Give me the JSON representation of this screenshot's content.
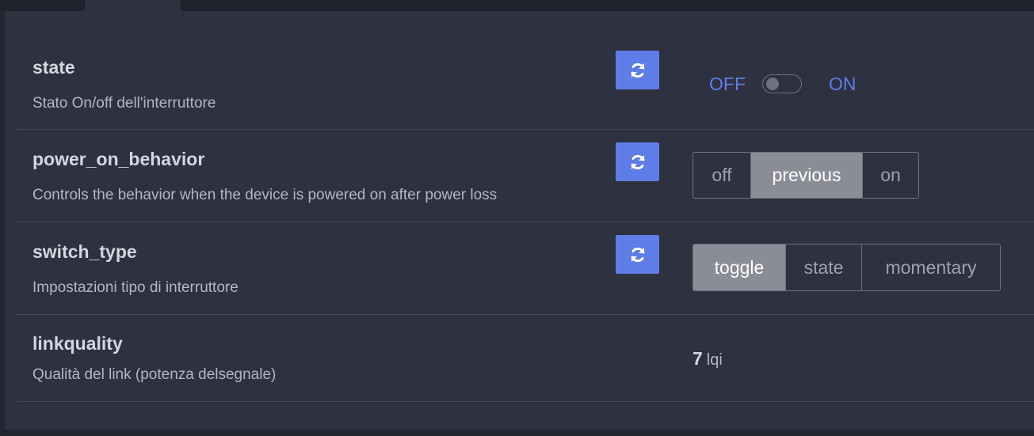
{
  "rows": [
    {
      "name": "state",
      "description": "Stato On/off dell'interruttore",
      "control": {
        "type": "switch",
        "off_label": "OFF",
        "on_label": "ON",
        "value": "OFF"
      }
    },
    {
      "name": "power_on_behavior",
      "description": "Controls the behavior when the device is powered on after power loss",
      "control": {
        "type": "segmented",
        "options": [
          "off",
          "previous",
          "on"
        ],
        "selected": "previous"
      }
    },
    {
      "name": "switch_type",
      "description": "Impostazioni tipo di interruttore",
      "control": {
        "type": "segmented",
        "options": [
          "toggle",
          "state",
          "momentary"
        ],
        "selected": "toggle"
      }
    },
    {
      "name": "linkquality",
      "description": "Qualità del link (potenza delsegnale)",
      "control": {
        "type": "readout",
        "value": "7",
        "unit": "lqi"
      }
    }
  ],
  "icons": {
    "refresh": "refresh-icon"
  },
  "colors": {
    "accent": "#5f7de6",
    "active_option": "#8a8d96",
    "panel": "#2e3140"
  }
}
